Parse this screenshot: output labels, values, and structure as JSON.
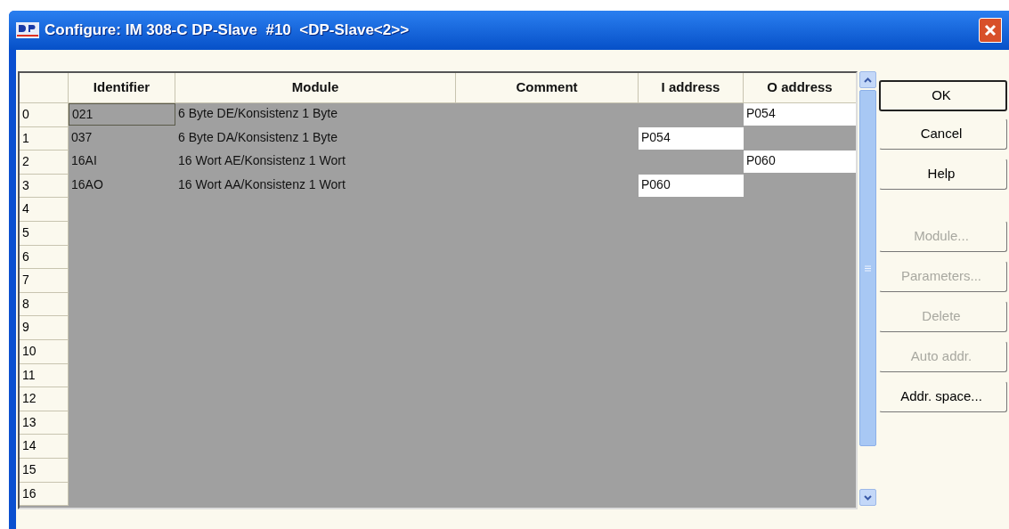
{
  "window": {
    "title": "Configure: IM 308-C DP-Slave  #10  <DP-Slave<2>>"
  },
  "table": {
    "columns": [
      "Identifier",
      "Module",
      "Comment",
      "I address",
      "O address"
    ],
    "rows": [
      {
        "index": "0",
        "identifier": "021",
        "module": "6 Byte DE/Konsistenz 1 Byte",
        "comment": "",
        "i_address": "",
        "o_address": "P054",
        "focused": true
      },
      {
        "index": "1",
        "identifier": "037",
        "module": "6 Byte DA/Konsistenz 1 Byte",
        "comment": "",
        "i_address": "P054",
        "o_address": "",
        "focused": false
      },
      {
        "index": "2",
        "identifier": "16AI",
        "module": "16 Wort AE/Konsistenz 1 Wort",
        "comment": "",
        "i_address": "",
        "o_address": "P060",
        "focused": false
      },
      {
        "index": "3",
        "identifier": "16AO",
        "module": "16 Wort AA/Konsistenz 1 Wort",
        "comment": "",
        "i_address": "P060",
        "o_address": "",
        "focused": false
      },
      {
        "index": "4"
      },
      {
        "index": "5"
      },
      {
        "index": "6"
      },
      {
        "index": "7"
      },
      {
        "index": "8"
      },
      {
        "index": "9"
      },
      {
        "index": "10"
      },
      {
        "index": "11"
      },
      {
        "index": "12"
      },
      {
        "index": "13"
      },
      {
        "index": "14"
      },
      {
        "index": "15"
      },
      {
        "index": "16"
      }
    ]
  },
  "buttons": [
    {
      "label": "OK",
      "default": true,
      "disabled": false
    },
    {
      "label": "Cancel",
      "default": false,
      "disabled": false
    },
    {
      "label": "Help",
      "default": false,
      "disabled": false
    },
    {
      "label": "Module...",
      "default": false,
      "disabled": true
    },
    {
      "label": "Parameters...",
      "default": false,
      "disabled": true
    },
    {
      "label": "Delete",
      "default": false,
      "disabled": true
    },
    {
      "label": "Auto addr.",
      "default": false,
      "disabled": true
    },
    {
      "label": "Addr. space...",
      "default": false,
      "disabled": false
    }
  ]
}
